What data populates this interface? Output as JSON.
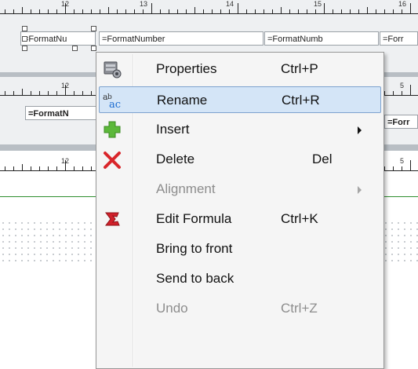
{
  "rulers": {
    "top_numbers": [
      "12",
      "13",
      "14",
      "15",
      "16"
    ],
    "mid_numbers": [
      "12",
      "5"
    ],
    "bot_numbers": [
      "12",
      "5"
    ]
  },
  "fields": {
    "row1": [
      "=FormatNu",
      "=FormatNumber",
      "=FormatNumb",
      "=Forr"
    ],
    "row2": [
      "=FormatN",
      "=Forr"
    ]
  },
  "menu": {
    "items": [
      {
        "label": "Properties",
        "shortcut": "Ctrl+P",
        "icon": "properties-icon",
        "enabled": true
      },
      {
        "label": "Rename",
        "shortcut": "Ctrl+R",
        "icon": "rename-icon",
        "enabled": true,
        "highlighted": true
      },
      {
        "label": "Insert",
        "shortcut": "",
        "icon": "plus-icon",
        "enabled": true,
        "submenu": true
      },
      {
        "label": "Delete",
        "shortcut": "Del",
        "icon": "delete-x-icon",
        "enabled": true
      },
      {
        "label": "Alignment",
        "shortcut": "",
        "icon": "",
        "enabled": false,
        "submenu": true
      },
      {
        "label": "Edit Formula",
        "shortcut": "Ctrl+K",
        "icon": "formula-sigma-icon",
        "enabled": true
      },
      {
        "label": "Bring to front",
        "shortcut": "",
        "icon": "",
        "enabled": true
      },
      {
        "label": "Send to back",
        "shortcut": "",
        "icon": "",
        "enabled": true
      },
      {
        "label": "Undo",
        "shortcut": "Ctrl+Z",
        "icon": "",
        "enabled": false
      }
    ]
  },
  "colors": {
    "highlight_bg": "#d4e5f7",
    "highlight_border": "#7da2ce",
    "disabled_text": "#8d8d8d",
    "delete_red": "#d9262b",
    "plus_green": "#5cb83a",
    "sigma_red": "#d0202a"
  }
}
